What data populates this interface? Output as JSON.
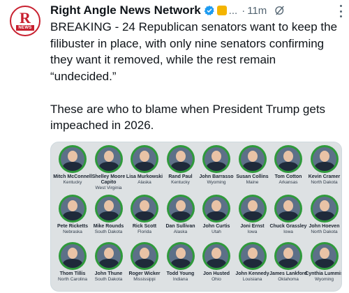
{
  "tweet": {
    "avatar_letter": "R",
    "avatar_text": "NEWS",
    "author_name": "Right Angle News Network",
    "ellipsis": "...",
    "separator": "·",
    "time": "11m",
    "paragraph1": "BREAKING - 24 Republican senators want to keep the filibuster in place, with only nine senators confirming they want it removed, while the rest remain “undecided.”",
    "paragraph2": "These are who to blame when President Trump gets impeached in 2026."
  },
  "colors": {
    "verified": "#1d9bf0",
    "badge": "#f4b400",
    "brand_red": "#c8202f",
    "portrait_ring": "#2f9a3b"
  },
  "icons": [
    "verified-icon",
    "gold-badge-icon",
    "grok-icon",
    "more-icon"
  ],
  "senators": [
    {
      "name": "Mitch McConnell",
      "state": "Kentucky"
    },
    {
      "name": "Shelley Moore Capito",
      "state": "West Virginia"
    },
    {
      "name": "Lisa Murkowski",
      "state": "Alaska"
    },
    {
      "name": "Rand Paul",
      "state": "Kentucky"
    },
    {
      "name": "John Barrasso",
      "state": "Wyoming"
    },
    {
      "name": "Susan Collins",
      "state": "Maine"
    },
    {
      "name": "Tom Cotton",
      "state": "Arkansas"
    },
    {
      "name": "Kevin Cramer",
      "state": "North Dakota"
    },
    {
      "name": "Pete Ricketts",
      "state": "Nebraska"
    },
    {
      "name": "Mike Rounds",
      "state": "South Dakota"
    },
    {
      "name": "Rick Scott",
      "state": "Florida"
    },
    {
      "name": "Dan Sullivan",
      "state": "Alaska"
    },
    {
      "name": "John Curtis",
      "state": "Utah"
    },
    {
      "name": "Joni Ernst",
      "state": "Iowa"
    },
    {
      "name": "Chuck Grassley",
      "state": "Iowa"
    },
    {
      "name": "John Hoeven",
      "state": "North Dakota"
    },
    {
      "name": "Thom Tillis",
      "state": "North Carolina"
    },
    {
      "name": "John Thune",
      "state": "South Dakota"
    },
    {
      "name": "Roger Wicker",
      "state": "Mississippi"
    },
    {
      "name": "Todd Young",
      "state": "Indiana"
    },
    {
      "name": "Jon Husted",
      "state": "Ohio"
    },
    {
      "name": "John Kennedy",
      "state": "Louisiana"
    },
    {
      "name": "James Lankford",
      "state": "Oklahoma"
    },
    {
      "name": "Cynthia Lummis",
      "state": "Wyoming"
    }
  ]
}
